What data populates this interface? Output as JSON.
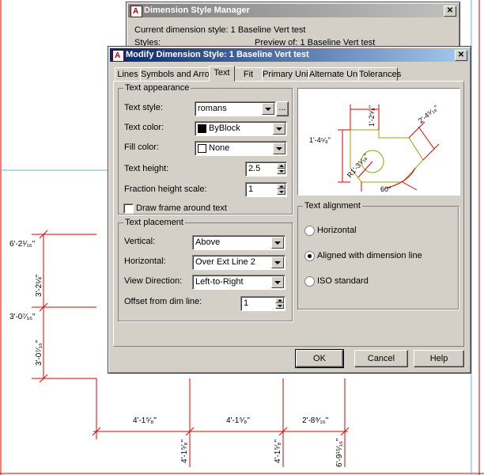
{
  "colors": {
    "dim_line": "#e00000",
    "geometry": "#a0a000",
    "title_active": "#0a246a",
    "title_inactive": "#808080"
  },
  "background_drawing": {
    "left_dims": [
      "6'-2¹⁄₁₆\"",
      "3'-2¼\"",
      "3'-0⁷⁄₁₆\"",
      "3'-0⁷⁄₁₆\""
    ],
    "bottom_dims_horizontal": [
      "4'-1⁵⁄₈\"",
      "4'-1⁵⁄₈\"",
      "2'-8⁹⁄₁₆\""
    ],
    "bottom_dims_vertical": [
      "4'-1⁵⁄₈\"",
      "4'-1⁵⁄₈\"",
      "6'-9¹⁵⁄₁₆\""
    ]
  },
  "manager": {
    "title": "Dimension Style Manager",
    "current_style": "Current dimension style: 1 Baseline Vert test",
    "styles_label": "Styles:",
    "preview_label": "Preview of: 1 Baseline Vert test",
    "close_glyph": "✕"
  },
  "dialog": {
    "title": "Modify Dimension Style: 1 Baseline Vert test",
    "close_glyph": "✕",
    "tabs": [
      "Lines",
      "Symbols and Arrows",
      "Text",
      "Fit",
      "Primary Units",
      "Alternate Units",
      "Tolerances"
    ],
    "active_tab": "Text",
    "appearance": {
      "title": "Text appearance",
      "style_label": "Text style:",
      "style_value": "romans",
      "ellipsis": "...",
      "color_label": "Text color:",
      "color_value": "ByBlock",
      "color_swatch": "#000000",
      "fill_label": "Fill color:",
      "fill_value": "None",
      "fill_swatch": "#ffffff",
      "height_label": "Text height:",
      "height_value": "2.5",
      "fraction_label": "Fraction height scale:",
      "fraction_value": "1",
      "frame_label": "Draw frame around text",
      "frame_checked": false
    },
    "placement": {
      "title": "Text placement",
      "vertical_label": "Vertical:",
      "vertical_value": "Above",
      "horizontal_label": "Horizontal:",
      "horizontal_value": "Over Ext Line 2",
      "view_label": "View Direction:",
      "view_value": "Left-to-Right",
      "offset_label": "Offset from dim line:",
      "offset_value": "1"
    },
    "preview": {
      "dim_top": "1'-2⁵⁄₈\"",
      "dim_left": "1'-4⁵⁄₈\"",
      "dim_right": "2'-4⁵⁄₁₆\"",
      "dim_radius": "R1'-3⁵⁄₁₆\"",
      "dim_angle": "60°"
    },
    "alignment": {
      "title": "Text alignment",
      "options": [
        "Horizontal",
        "Aligned with dimension line",
        "ISO standard"
      ],
      "selected": "Aligned with dimension line"
    },
    "buttons": {
      "ok": "OK",
      "cancel": "Cancel",
      "help": "Help"
    }
  }
}
